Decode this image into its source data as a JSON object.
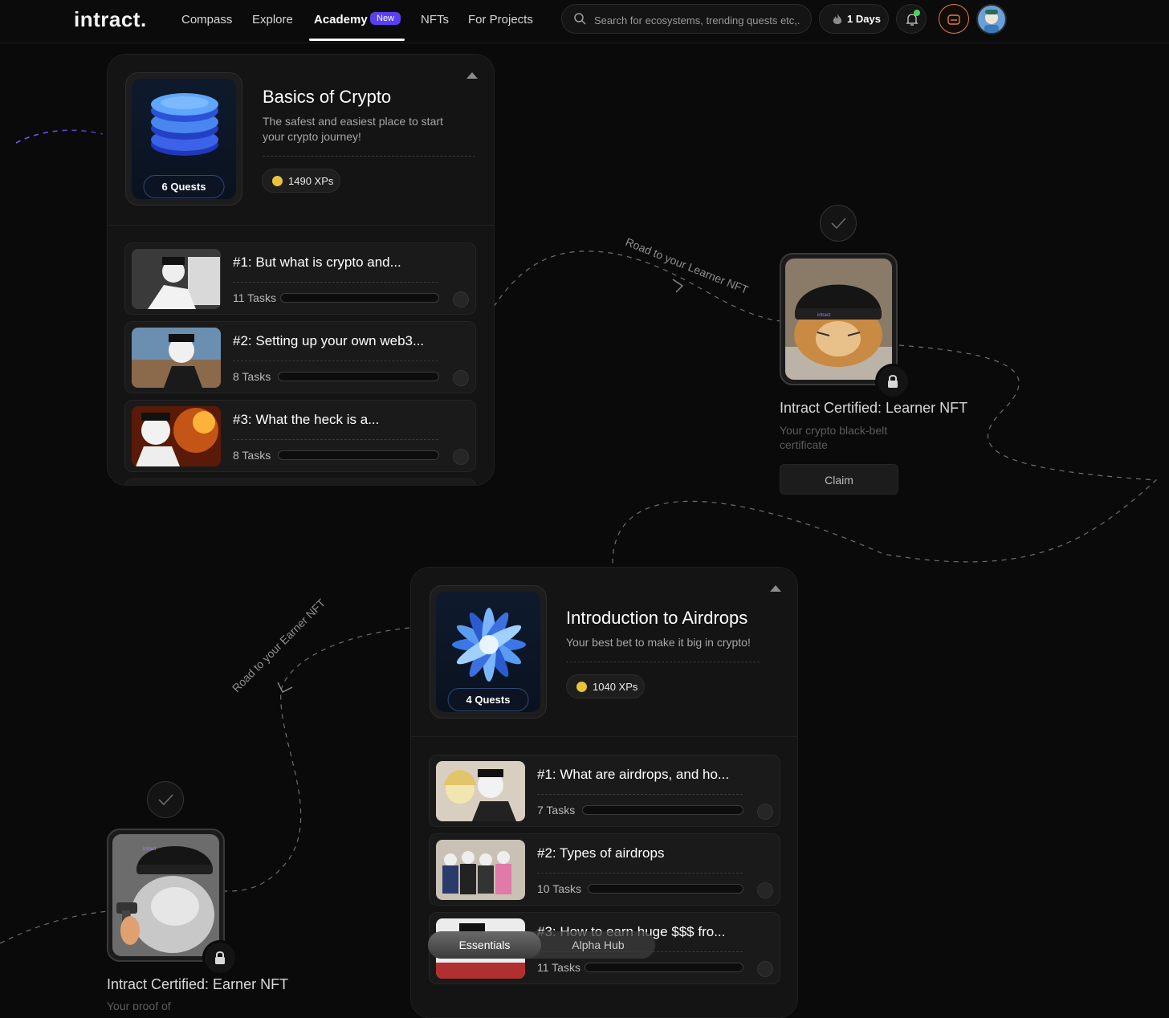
{
  "nav": {
    "logo": "intract.",
    "links": [
      "Compass",
      "Explore",
      "Academy",
      "NFTs",
      "For Projects"
    ],
    "new_badge": "New",
    "search_placeholder": "Search for ecosystems, trending quests etc,.",
    "streak": "1 Days"
  },
  "courses": [
    {
      "title": "Basics of Crypto",
      "description": "The safest and easiest place to start your crypto journey!",
      "quest_count": "6 Quests",
      "xp": "1490 XPs",
      "quests": [
        {
          "title": "#1: But what is crypto and...",
          "tasks": "11 Tasks",
          "progress": 0
        },
        {
          "title": "#2: Setting up your own web3...",
          "tasks": "8 Tasks",
          "progress": 0
        },
        {
          "title": "#3: What the heck is a...",
          "tasks": "8 Tasks",
          "progress": 0
        }
      ]
    },
    {
      "title": "Introduction to Airdrops",
      "description": "Your best bet to make it big in crypto!",
      "quest_count": "4 Quests",
      "xp": "1040 XPs",
      "quests": [
        {
          "title": "#1: What are airdrops, and ho...",
          "tasks": "7 Tasks",
          "progress": 0
        },
        {
          "title": "#2: Types of airdrops",
          "tasks": "10 Tasks",
          "progress": 0
        },
        {
          "title": "#3: How to earn huge $$$ fro...",
          "tasks": "11 Tasks",
          "progress": 0
        }
      ]
    }
  ],
  "nfts": [
    {
      "title": "Intract Certified: Learner NFT",
      "description": "Your crypto black-belt certificate",
      "claim_label": "Claim",
      "road_label": "Road to your Learner NFT"
    },
    {
      "title": "Intract Certified: Earner NFT",
      "description": "Your proof of",
      "road_label": "Road to your Earner NFT"
    }
  ],
  "toggle": {
    "active": "Essentials",
    "inactive": "Alpha Hub"
  },
  "colors": {
    "accent_purple": "#5b3ff2",
    "coin": "#e8c23a",
    "streak_online": "#4ad35e",
    "wallet_ring": "#e07b48"
  }
}
